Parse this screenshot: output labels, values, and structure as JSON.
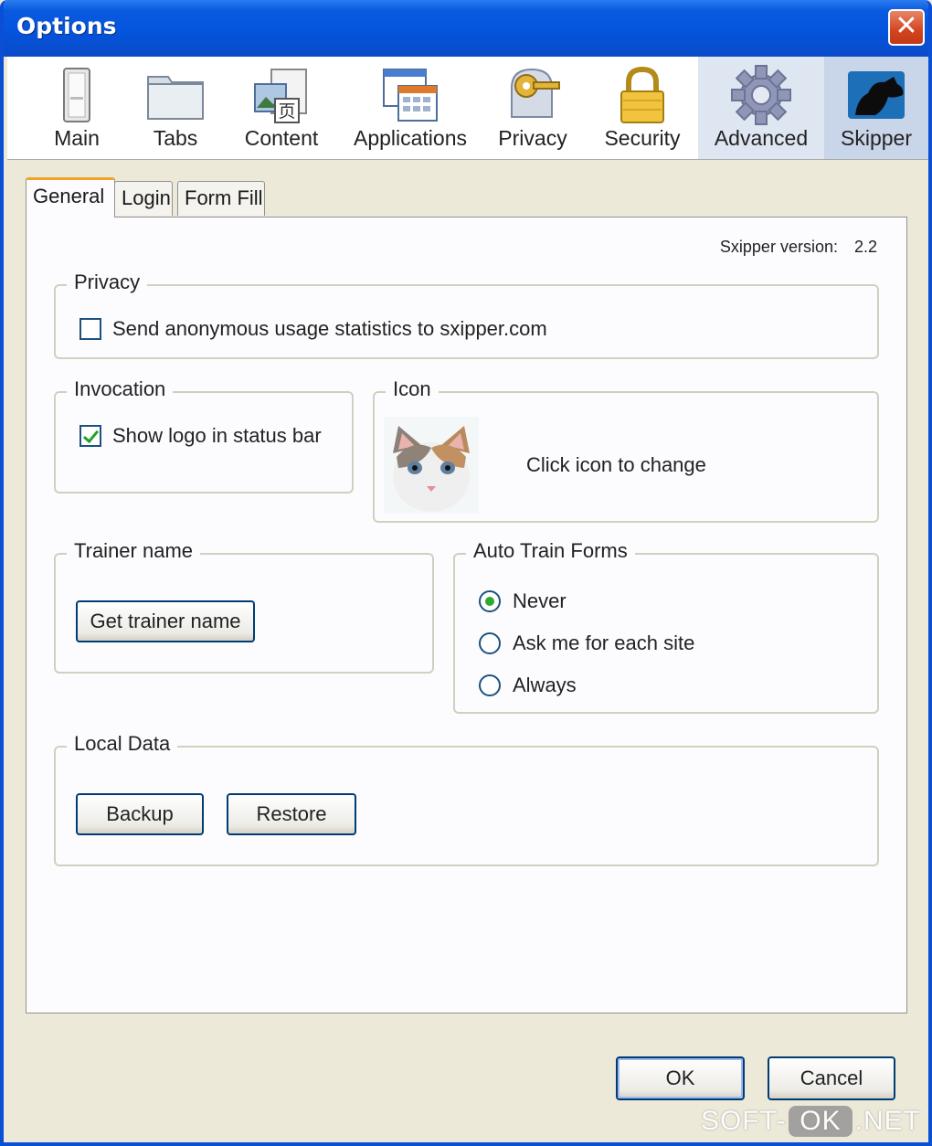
{
  "window": {
    "title": "Options",
    "close_glyph": "✕"
  },
  "toolbar": {
    "panes": [
      {
        "label": "Main",
        "icon": "main-pane-icon"
      },
      {
        "label": "Tabs",
        "icon": "tabs-pane-icon"
      },
      {
        "label": "Content",
        "icon": "content-pane-icon"
      },
      {
        "label": "Applications",
        "icon": "applications-pane-icon"
      },
      {
        "label": "Privacy",
        "icon": "privacy-pane-icon"
      },
      {
        "label": "Security",
        "icon": "security-lock-icon"
      },
      {
        "label": "Advanced",
        "icon": "advanced-gear-icon"
      },
      {
        "label": "Skipper",
        "icon": "skipper-dog-icon"
      }
    ],
    "selected": "Skipper"
  },
  "tabs": [
    {
      "label": "General",
      "active": true
    },
    {
      "label": "Login",
      "active": false
    },
    {
      "label": "Form Fill",
      "active": false
    }
  ],
  "general": {
    "version_label": "Sxipper version:",
    "version_value": "2.2",
    "privacy": {
      "legend": "Privacy",
      "checkbox_label": "Send anonymous usage statistics to sxipper.com",
      "checked": false
    },
    "invocation": {
      "legend": "Invocation",
      "checkbox_label": "Show logo in status bar",
      "checked": true
    },
    "icon": {
      "legend": "Icon",
      "hint": "Click icon to change",
      "image": "kitten-image"
    },
    "trainer": {
      "legend": "Trainer name",
      "button": "Get trainer name"
    },
    "auto_train": {
      "legend": "Auto Train Forms",
      "options": [
        "Never",
        "Ask me for each site",
        "Always"
      ],
      "selected": "Never"
    },
    "local_data": {
      "legend": "Local Data",
      "backup_button": "Backup",
      "restore_button": "Restore"
    }
  },
  "footer": {
    "ok_button": "OK",
    "cancel_button": "Cancel"
  },
  "watermark": {
    "left": "SOFT-",
    "middle": "OK",
    "right": ".NET"
  }
}
